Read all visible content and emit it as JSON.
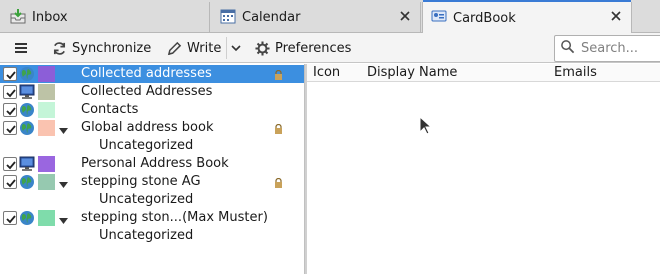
{
  "tabs": [
    {
      "label": "Inbox",
      "icon": "inbox-icon",
      "closable": false,
      "active": false
    },
    {
      "label": "Calendar",
      "icon": "calendar-icon",
      "closable": true,
      "active": false
    },
    {
      "label": "CardBook",
      "icon": "cardbook-icon",
      "closable": true,
      "active": true
    }
  ],
  "toolbar": {
    "menu_icon": "hamburger-menu-icon",
    "synchronize_label": "Synchronize",
    "write_label": "Write",
    "preferences_label": "Preferences",
    "search_placeholder": "Search..."
  },
  "address_books": [
    {
      "label": "Collected addresses",
      "type": "remote",
      "color": "#8c5ed8",
      "checked": true,
      "locked": true,
      "expandable": false,
      "selected": true
    },
    {
      "label": "Collected Addresses",
      "type": "local",
      "color": "#bdc3a6",
      "checked": true,
      "locked": false,
      "expandable": false,
      "selected": false
    },
    {
      "label": "Contacts",
      "type": "remote",
      "color": "#c4f5d8",
      "checked": true,
      "locked": false,
      "expandable": false,
      "selected": false
    },
    {
      "label": "Global address book",
      "type": "remote",
      "color": "#fac3b0",
      "checked": true,
      "locked": true,
      "expandable": true,
      "selected": false
    },
    {
      "label": "Uncategorized",
      "sub": true
    },
    {
      "label": "Personal Address Book",
      "type": "local",
      "color": "#9a66e0",
      "checked": true,
      "locked": false,
      "expandable": false,
      "selected": false
    },
    {
      "label": "stepping stone AG",
      "type": "remote",
      "color": "#96c9b0",
      "checked": true,
      "locked": true,
      "expandable": true,
      "selected": false
    },
    {
      "label": "Uncategorized",
      "sub": true
    },
    {
      "label": "stepping ston...(Max Muster)",
      "type": "remote",
      "color": "#7fdcab",
      "checked": true,
      "locked": false,
      "expandable": true,
      "selected": false
    },
    {
      "label": "Uncategorized",
      "sub": true
    }
  ],
  "contacts_columns": [
    "Icon",
    "Display Name",
    "Emails"
  ],
  "colors": {
    "accent": "#3c8fe0",
    "tab_indicator": "#3a7bd5"
  }
}
